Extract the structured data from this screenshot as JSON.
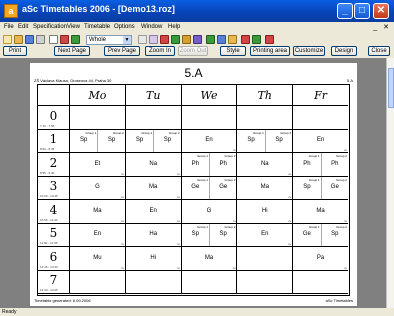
{
  "window": {
    "title": "aSc Timetables 2006 - [Demo13.roz]",
    "controls": {
      "minimize": "_",
      "maximize": "□",
      "close": "✕"
    }
  },
  "menu": {
    "items": [
      "File",
      "Edit",
      "Specification",
      "View",
      "Timetable",
      "Options",
      "Window",
      "Help"
    ],
    "mdi_controls": "_ ✕"
  },
  "toolbar": {
    "zoom_value": "Whole",
    "icons": [
      "new-icon",
      "open-icon",
      "save-icon",
      "print-icon",
      "separator",
      "generate-icon",
      "teacher-icon",
      "class-icon",
      "room-icon",
      "checklist-icon",
      "check-icon",
      "help-icon"
    ],
    "icon_colors": [
      "#f7e9a6",
      "#e6b84d",
      "#5a7fd6",
      "#8a8a8a",
      "#d24545",
      "#3a9a3a",
      "#d6a12a",
      "#7a5fc2",
      "#3a9a3a",
      "#5a7fd6",
      "#d24545",
      "#3a9a3a",
      "#e6b84d",
      "#d24545"
    ]
  },
  "preview_buttons": {
    "print": "Print",
    "next_page": "Next Page",
    "prev_page": "Prev Page",
    "zoom_in": "Zoom In",
    "zoom_out": "Zoom Out",
    "style": "Style",
    "printing_area": "Printing area",
    "customize": "Customize",
    "design": "Design",
    "close": "Close"
  },
  "sheet": {
    "class_name": "5.A",
    "school_address": "ZŠ Václava Klausa, Groseova 44, Praha 30",
    "class_small": "5.A",
    "footer_left": "Timetable generated: 6.09.2006",
    "footer_right": "aSc Timetables",
    "days": [
      "Mo",
      "Tu",
      "We",
      "Th",
      "Fr"
    ],
    "periods": [
      {
        "num": "0",
        "time": "7:10 - 7:55"
      },
      {
        "num": "1",
        "time": "8:00 - 8:45"
      },
      {
        "num": "2",
        "time": "8:55 - 9:40"
      },
      {
        "num": "3",
        "time": "10:00 - 10:45"
      },
      {
        "num": "4",
        "time": "10:55 - 11:40"
      },
      {
        "num": "5",
        "time": "11:50 - 12:35"
      },
      {
        "num": "6",
        "time": "12:45 - 13:30"
      },
      {
        "num": "7",
        "time": "13:40 - 14:25"
      }
    ],
    "rows": [
      [
        [],
        [],
        [],
        [],
        []
      ],
      [
        [
          {
            "s": "Sp",
            "g": "Group 1"
          },
          {
            "s": "Sp",
            "g": "Group 2"
          }
        ],
        [
          {
            "s": "Sp",
            "g": "Group 1"
          },
          {
            "s": "Sp",
            "g": "Group 2"
          }
        ],
        [
          {
            "s": "En"
          }
        ],
        [
          {
            "s": "Sp",
            "g": "Group 1"
          },
          {
            "s": "Sp",
            "g": "Group 2"
          }
        ],
        [
          {
            "s": "En"
          }
        ]
      ],
      [
        [
          {
            "s": "Et"
          }
        ],
        [
          {
            "s": "Na"
          }
        ],
        [
          {
            "s": "Ph",
            "g": "Group 1"
          },
          {
            "s": "Ph",
            "g": "Group 2"
          }
        ],
        [
          {
            "s": "Na"
          }
        ],
        [
          {
            "s": "Ph",
            "g": "Group 1"
          },
          {
            "s": "Ph",
            "g": "Group 2"
          }
        ]
      ],
      [
        [
          {
            "s": "G"
          }
        ],
        [
          {
            "s": "Ma"
          }
        ],
        [
          {
            "s": "Ge",
            "g": "Group 1"
          },
          {
            "s": "Ge",
            "g": "Group 2"
          }
        ],
        [
          {
            "s": "Ma"
          }
        ],
        [
          {
            "s": "Sp",
            "g": "Group 1"
          },
          {
            "s": "Ge",
            "g": "Group 2"
          }
        ]
      ],
      [
        [
          {
            "s": "Ma"
          }
        ],
        [
          {
            "s": "En"
          }
        ],
        [
          {
            "s": "G"
          }
        ],
        [
          {
            "s": "Hi"
          }
        ],
        [
          {
            "s": "Ma"
          }
        ]
      ],
      [
        [
          {
            "s": "En"
          }
        ],
        [
          {
            "s": "Ha"
          }
        ],
        [
          {
            "s": "Sp",
            "g": "Group 1"
          },
          {
            "s": "Sp",
            "g": "Group 2"
          }
        ],
        [
          {
            "s": "En"
          }
        ],
        [
          {
            "s": "Ge",
            "g": "Group 1"
          },
          {
            "s": "Sp",
            "g": "Group 2"
          }
        ]
      ],
      [
        [
          {
            "s": "Mu"
          }
        ],
        [
          {
            "s": "Hi"
          }
        ],
        [
          {
            "s": "Ma"
          }
        ],
        [],
        [
          {
            "s": "Pa"
          }
        ]
      ],
      [
        [],
        [],
        [],
        [],
        []
      ]
    ]
  },
  "status": {
    "text": "Ready"
  }
}
